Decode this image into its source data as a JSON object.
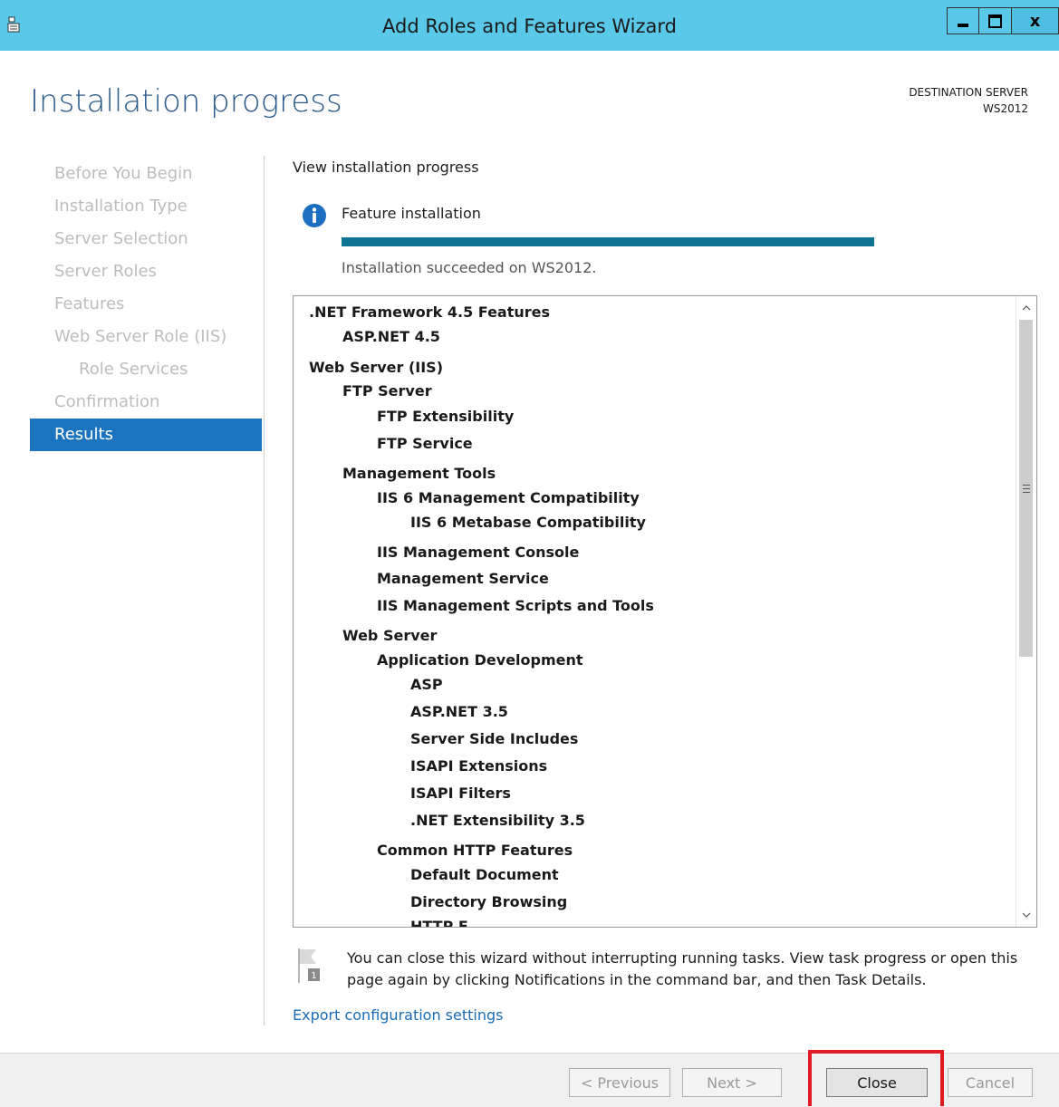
{
  "window": {
    "title": "Add Roles and Features Wizard",
    "minimize_glyph": "",
    "maximize_glyph": "",
    "close_glyph": "x"
  },
  "header": {
    "page_title": "Installation progress",
    "destination_label": "DESTINATION SERVER",
    "destination_server": "WS2012"
  },
  "nav": {
    "items": [
      {
        "label": "Before You Begin"
      },
      {
        "label": "Installation Type"
      },
      {
        "label": "Server Selection"
      },
      {
        "label": "Server Roles"
      },
      {
        "label": "Features"
      },
      {
        "label": "Web Server Role (IIS)"
      },
      {
        "label": "Role Services"
      },
      {
        "label": "Confirmation"
      },
      {
        "label": "Results"
      }
    ],
    "active": "Results"
  },
  "main": {
    "section_label": "View installation progress",
    "feature_label": "Feature installation",
    "progress_fraction": 1.0,
    "status_text": "Installation succeeded on WS2012.",
    "items": [
      ".NET Framework 4.5 Features",
      "ASP.NET 4.5",
      "Web Server (IIS)",
      "FTP Server",
      "FTP Extensibility",
      "FTP Service",
      "Management Tools",
      "IIS 6 Management Compatibility",
      "IIS 6 Metabase Compatibility",
      "IIS Management Console",
      "Management Service",
      "IIS Management Scripts and Tools",
      "Web Server",
      "Application Development",
      "ASP",
      "ASP.NET 3.5",
      "Server Side Includes",
      "ISAPI Extensions",
      "ISAPI Filters",
      ".NET Extensibility 3.5",
      "Common HTTP Features",
      "Default Document",
      "Directory Browsing",
      "HTTP E..."
    ],
    "note_text": "You can close this wizard without interrupting running tasks. View task progress or open this page again by clicking Notifications in the command bar, and then Task Details.",
    "note_badge": "1",
    "export_link": "Export configuration settings"
  },
  "footer": {
    "previous": "< Previous",
    "next": "Next >",
    "close": "Close",
    "cancel": "Cancel"
  },
  "colors": {
    "titlebar": "#5ac8e8",
    "accent": "#1c74bf",
    "progress": "#0f7494",
    "highlight": "#e01b24"
  }
}
